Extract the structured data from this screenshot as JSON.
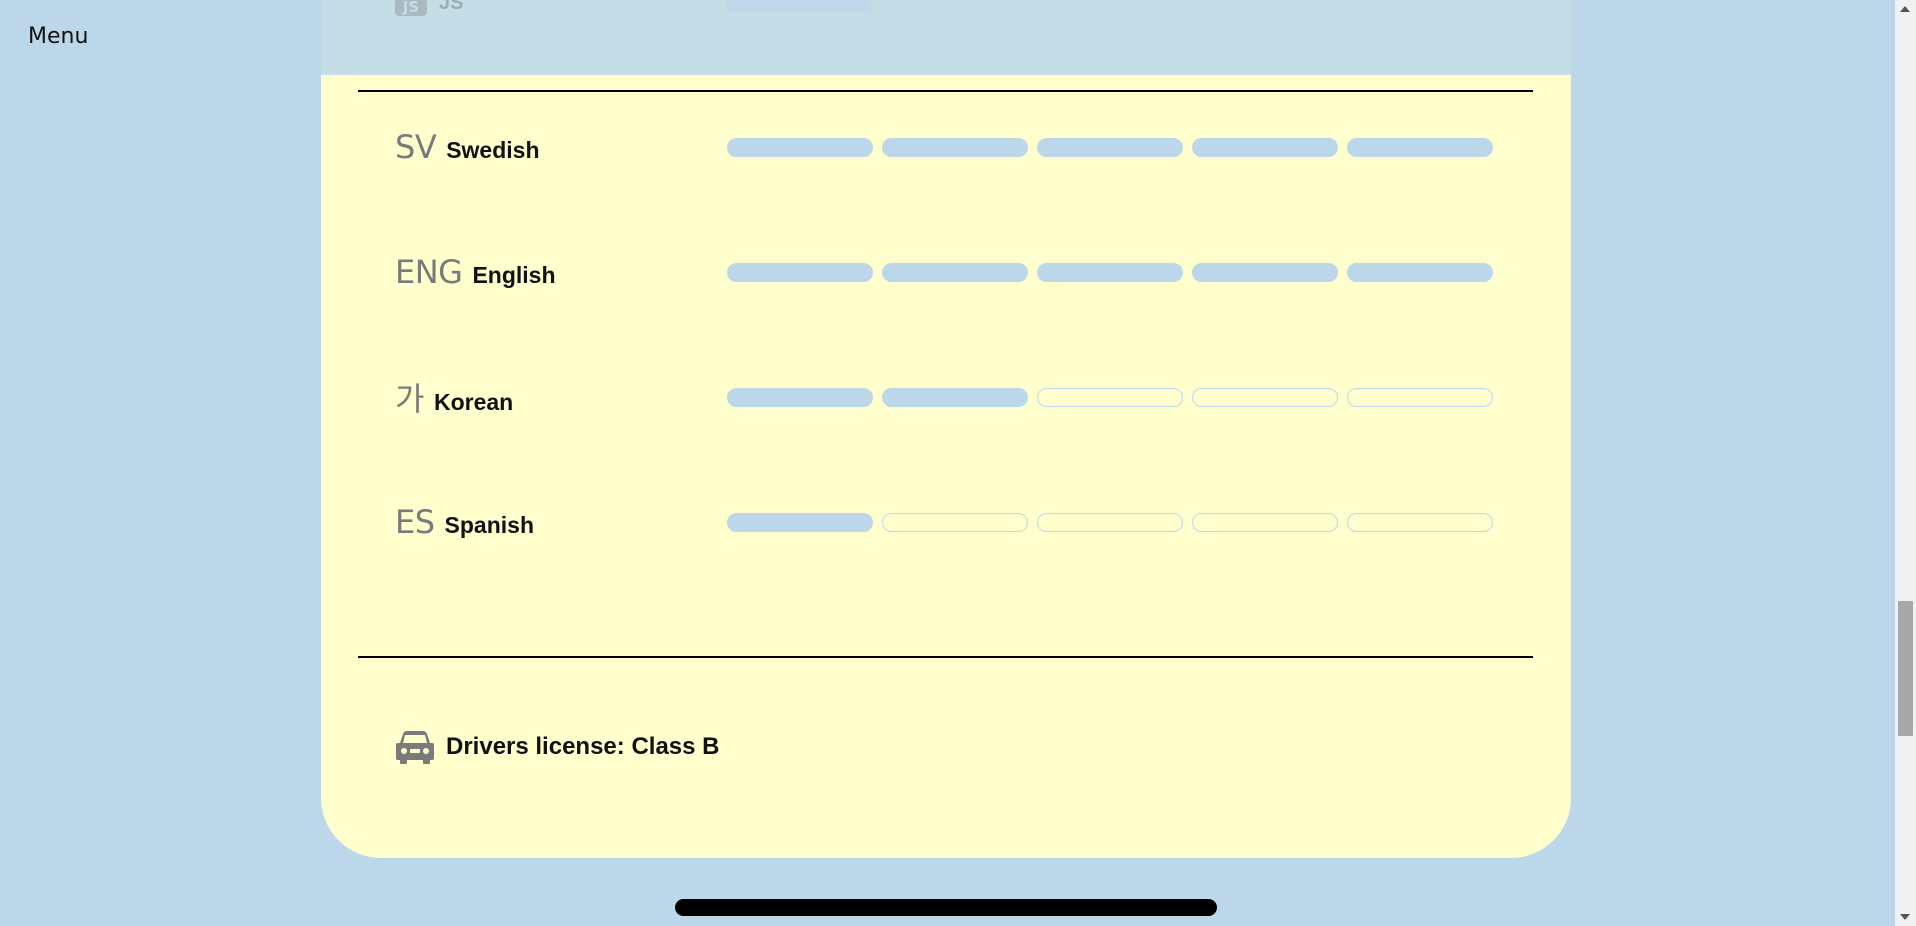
{
  "nav": {
    "menu_label": "Menu"
  },
  "overlay": {
    "skill_icon": "js-icon",
    "skill_label": "JS"
  },
  "languages": {
    "max_level": 5,
    "items": [
      {
        "code": "SV",
        "name": "Swedish",
        "level": 5
      },
      {
        "code": "ENG",
        "name": "English",
        "level": 5
      },
      {
        "code": "가",
        "name": "Korean",
        "level": 2
      },
      {
        "code": "ES",
        "name": "Spanish",
        "level": 1
      }
    ]
  },
  "license": {
    "icon": "car-icon",
    "text": "Drivers license: Class B"
  },
  "colors": {
    "page_background": "#bdd7ea",
    "card_background": "#feffcd",
    "header_overlay": "#c4dde6",
    "bar_fill": "#bdd7ea",
    "code_text": "#7a7a7a"
  }
}
